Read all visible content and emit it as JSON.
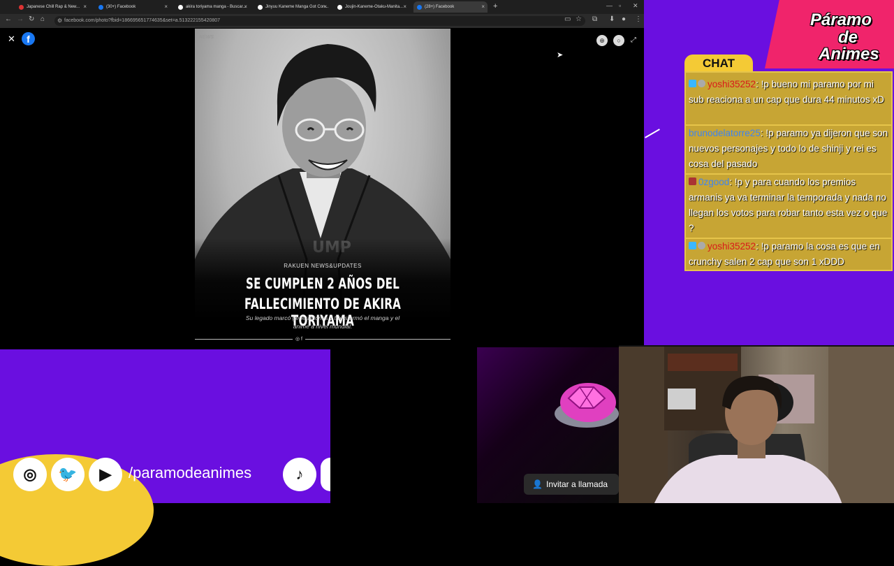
{
  "browser": {
    "tabs": [
      {
        "label": "Japanese Chill Rap & New..."
      },
      {
        "label": "(30+) Facebook"
      },
      {
        "label": "akira toriyama manga - Buscar..."
      },
      {
        "label": "Jinyuu Kaneme Manga Got Con..."
      },
      {
        "label": "Joujin-Kaneme-Otaku-Manita..."
      },
      {
        "label": "(28+) Facebook"
      }
    ],
    "url": "facebook.com/photo?fbid=186695651774635&set=a.513222155420807"
  },
  "post": {
    "news_tag": "NEWS",
    "source": "RAKUEN NEWS&UPDATES",
    "headline_line1": "SE CUMPLEN 2 AÑOS DEL",
    "headline_line2": "FALLECIMIENTO DE AKIRA TORIYAMA",
    "sub_line1": "Su legado marcó generaciones y transformó el manga y el",
    "sub_line2": "anime a nivel mundial."
  },
  "overlay": {
    "logo_line1": "Páramo",
    "logo_line2": "de",
    "logo_line3": "Animes",
    "chat_label": "CHAT",
    "handle": "/paramodeanimes",
    "invite_label": "Invitar a llamada"
  },
  "chat": [
    {
      "user": "yoshi35252",
      "text": ": !p bueno mi paramo por mi sub reaciona a un cap que dura 44 minutos xD"
    },
    {
      "user": "brunodelatorre25",
      "text": ": !p paramo ya dijeron que son nuevos personajes y todo lo de shinji y rei es cosa del pasado"
    },
    {
      "user": "0zgood",
      "text": ": !p y para cuando los premios armanis ya va terminar la temporada y nada no llegan los votos para robar tanto esta vez o que ?"
    },
    {
      "user": "yoshi35252",
      "text": ": !p paramo la cosa es que en crunchy salen 2 cap que son 1 xDDD"
    }
  ],
  "colors": {
    "purple": "#6a0fe0",
    "pink": "#f0246b",
    "yellow": "#f4ca35",
    "facebook": "#1877f2"
  }
}
